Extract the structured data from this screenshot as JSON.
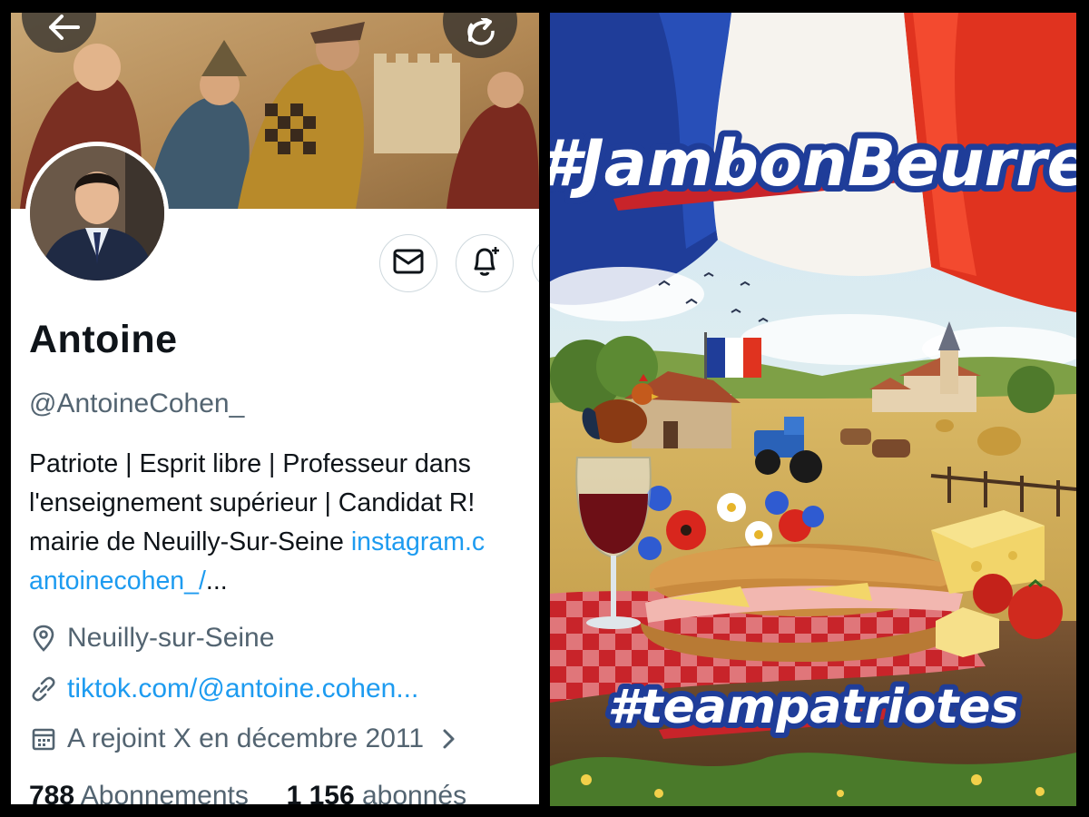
{
  "profile": {
    "display_name": "Antoine",
    "handle": "@AntoineCohen_",
    "bio_line1": "Patriote | Esprit libre | Professeur dans",
    "bio_line2": "l'enseignement supérieur | Candidat R!",
    "bio_line3_text": "mairie de Neuilly-Sur-Seine ",
    "bio_line3_link": "instagram.c",
    "bio_line4_link": "antoinecohen_/",
    "bio_line4_ellipsis": "...",
    "location": "Neuilly-sur-Seine",
    "website": "tiktok.com/@antoine.cohen...",
    "joined": "A rejoint X en décembre 2011",
    "following_count": "788",
    "following_label": "Abonnements",
    "followers_count": "1 156",
    "followers_label": "abonnés"
  },
  "icons": {
    "back": "back-arrow-icon",
    "share": "share-icon",
    "message": "envelope-icon",
    "notify": "bell-plus-icon",
    "location": "location-pin-icon",
    "website": "link-icon",
    "joined": "calendar-icon",
    "chevron": "chevron-right-icon"
  },
  "poster": {
    "top_hashtag": "#JambonBeurre",
    "bottom_hashtag": "#teampatriotes"
  },
  "colors": {
    "link": "#1d9bf0",
    "secondary_text": "#536471",
    "primary_text": "#0f1419",
    "flag_blue": "#1f3d99",
    "flag_red": "#e0331f"
  }
}
